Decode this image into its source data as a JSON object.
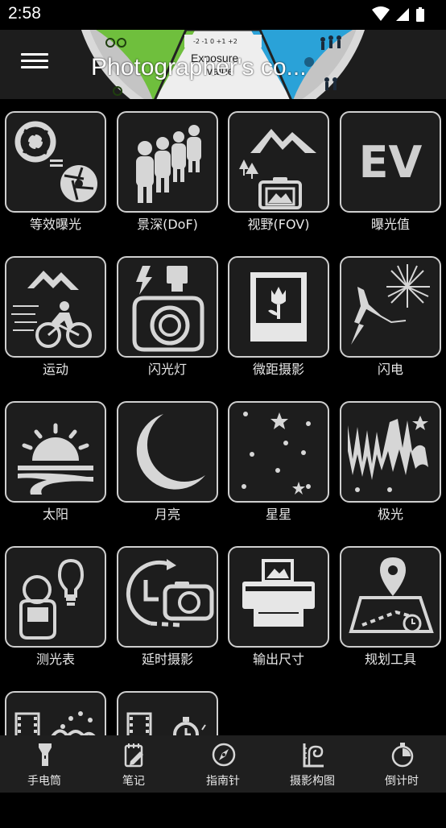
{
  "status_bar": {
    "time": "2:58",
    "icons": [
      "wifi-icon",
      "signal-icon",
      "battery-icon"
    ]
  },
  "app_bar": {
    "title": "Photographer's co...",
    "menu_icon": "menu-icon",
    "dial": {
      "exposure_label": "Exposure",
      "value_label": "value",
      "scale": "-2 -1 0 +1 +2"
    }
  },
  "tools": [
    {
      "label": "等效曝光",
      "icon": "aperture-pair-icon"
    },
    {
      "label": "景深(DoF)",
      "icon": "people-depth-icon"
    },
    {
      "label": "视野(FOV)",
      "icon": "landscape-camera-icon"
    },
    {
      "label": "曝光值",
      "icon": "ev-icon",
      "icon_text": "EV"
    },
    {
      "label": "运动",
      "icon": "cyclist-icon"
    },
    {
      "label": "闪光灯",
      "icon": "flash-camera-icon"
    },
    {
      "label": "微距摄影",
      "icon": "macro-flower-icon"
    },
    {
      "label": "闪电",
      "icon": "lightning-fireworks-icon"
    },
    {
      "label": "太阳",
      "icon": "sunset-icon"
    },
    {
      "label": "月亮",
      "icon": "moon-icon"
    },
    {
      "label": "星星",
      "icon": "stars-icon"
    },
    {
      "label": "极光",
      "icon": "aurora-icon"
    },
    {
      "label": "测光表",
      "icon": "light-meter-icon"
    },
    {
      "label": "延时摄影",
      "icon": "timelapse-camera-icon"
    },
    {
      "label": "输出尺寸",
      "icon": "printer-icon"
    },
    {
      "label": "规划工具",
      "icon": "map-planner-icon"
    },
    {
      "label": "",
      "icon": "film-splash-icon"
    },
    {
      "label": "",
      "icon": "film-stopwatch-icon"
    }
  ],
  "bottom_nav": [
    {
      "label": "手电筒",
      "icon": "flashlight-icon"
    },
    {
      "label": "笔记",
      "icon": "notes-icon"
    },
    {
      "label": "指南针",
      "icon": "compass-icon"
    },
    {
      "label": "摄影构图",
      "icon": "composition-icon"
    },
    {
      "label": "倒计时",
      "icon": "countdown-icon"
    }
  ],
  "colors": {
    "background": "#000000",
    "tile_background": "#1d1d1d",
    "tile_border": "#cfcfcf",
    "icon": "#d6d6d6",
    "bottom_bar": "#1f1f1f"
  }
}
